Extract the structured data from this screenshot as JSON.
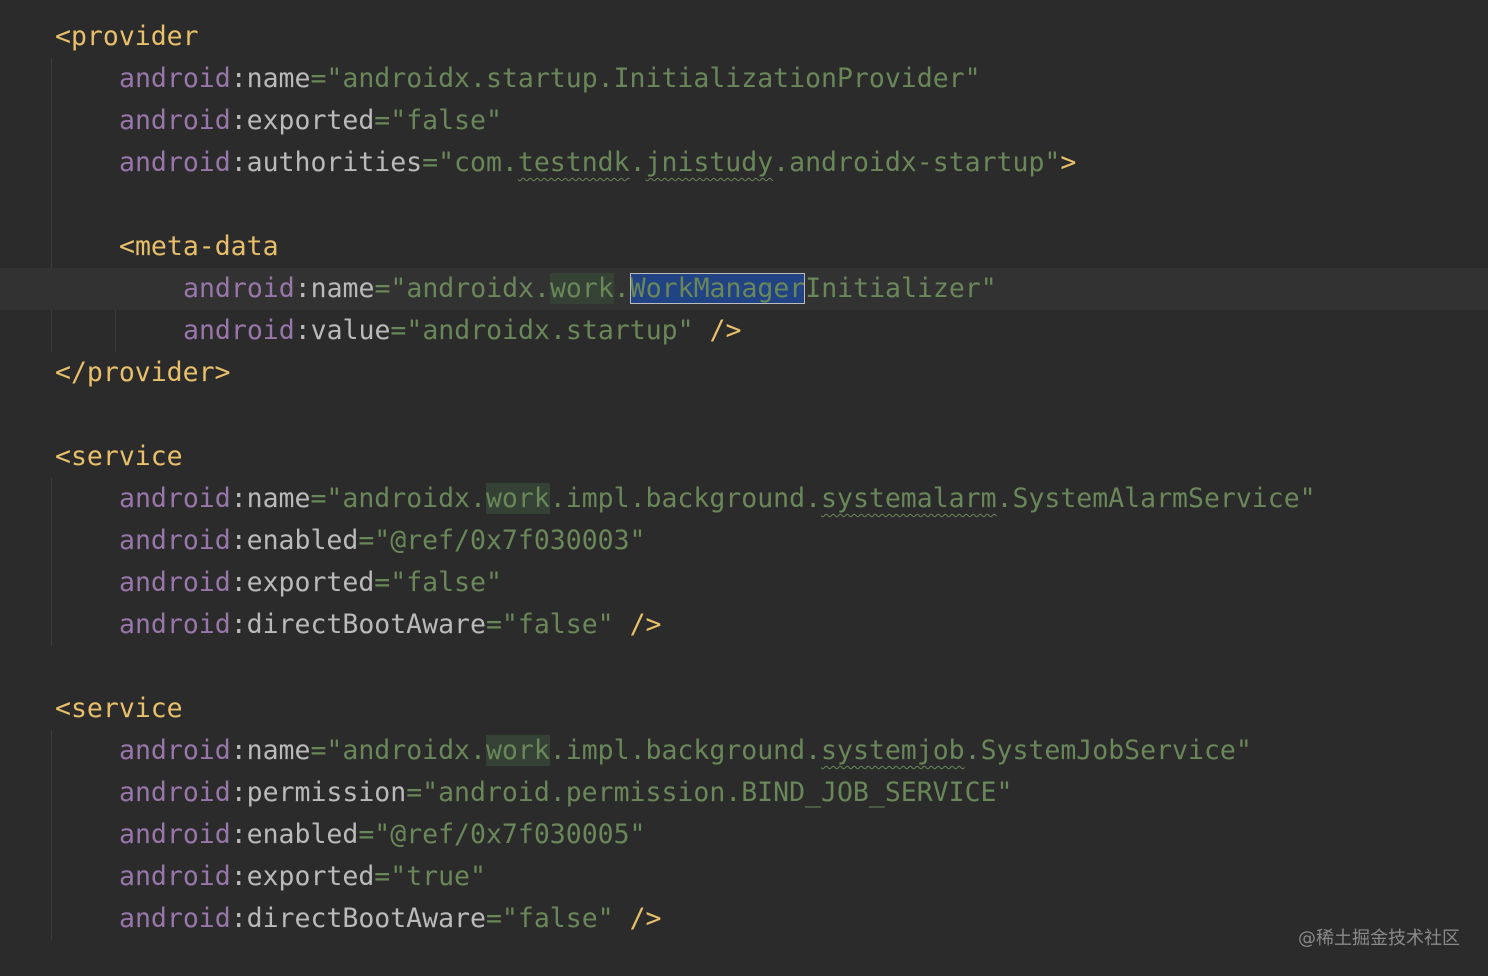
{
  "editor": {
    "file_language": "XML",
    "watermark": "@稀土掘金技术社区",
    "lines": [
      {
        "indent": 0,
        "tokens": [
          {
            "t": "tag",
            "v": "<provider"
          }
        ]
      },
      {
        "indent": 1,
        "tokens": [
          {
            "t": "ns",
            "v": "android"
          },
          {
            "t": "attr",
            "v": ":name"
          },
          {
            "t": "val",
            "v": "=\"androidx.startup.InitializationProvider\""
          }
        ]
      },
      {
        "indent": 1,
        "tokens": [
          {
            "t": "ns",
            "v": "android"
          },
          {
            "t": "attr",
            "v": ":exported"
          },
          {
            "t": "val",
            "v": "=\"false\""
          }
        ]
      },
      {
        "indent": 1,
        "tokens": [
          {
            "t": "ns",
            "v": "android"
          },
          {
            "t": "attr",
            "v": ":authorities"
          },
          {
            "t": "val",
            "v": "=\"com."
          },
          {
            "t": "val",
            "v": "testndk",
            "typo": true
          },
          {
            "t": "val",
            "v": "."
          },
          {
            "t": "val",
            "v": "jnistudy",
            "typo": true
          },
          {
            "t": "val",
            "v": ".androidx-startup\""
          },
          {
            "t": "punct",
            "v": ">"
          }
        ]
      },
      {
        "indent": 0,
        "tokens": []
      },
      {
        "indent": 1,
        "tokens": [
          {
            "t": "tag",
            "v": "<meta-data"
          }
        ]
      },
      {
        "indent": 2,
        "current": true,
        "tokens": [
          {
            "t": "ns",
            "v": "android"
          },
          {
            "t": "attr",
            "v": ":name"
          },
          {
            "t": "val",
            "v": "=\"androidx."
          },
          {
            "t": "val",
            "v": "work",
            "hl": "match"
          },
          {
            "t": "val",
            "v": "."
          },
          {
            "t": "val",
            "v": "WorkManager",
            "hl": "sel"
          },
          {
            "t": "val",
            "v": "Initializer\""
          }
        ]
      },
      {
        "indent": 2,
        "tokens": [
          {
            "t": "ns",
            "v": "android"
          },
          {
            "t": "attr",
            "v": ":value"
          },
          {
            "t": "val",
            "v": "=\"androidx.startup\" "
          },
          {
            "t": "punct",
            "v": "/>"
          }
        ]
      },
      {
        "indent": 0,
        "tokens": [
          {
            "t": "tag",
            "v": "</provider>"
          }
        ]
      },
      {
        "indent": 0,
        "tokens": []
      },
      {
        "indent": 0,
        "tokens": [
          {
            "t": "tag",
            "v": "<service"
          }
        ]
      },
      {
        "indent": 1,
        "tokens": [
          {
            "t": "ns",
            "v": "android"
          },
          {
            "t": "attr",
            "v": ":name"
          },
          {
            "t": "val",
            "v": "=\"androidx."
          },
          {
            "t": "val",
            "v": "work",
            "hl": "match"
          },
          {
            "t": "val",
            "v": ".impl.background."
          },
          {
            "t": "val",
            "v": "systemalarm",
            "typo": true
          },
          {
            "t": "val",
            "v": ".SystemAlarmService\""
          }
        ]
      },
      {
        "indent": 1,
        "tokens": [
          {
            "t": "ns",
            "v": "android"
          },
          {
            "t": "attr",
            "v": ":enabled"
          },
          {
            "t": "val",
            "v": "=\"@ref/0x7f030003\""
          }
        ]
      },
      {
        "indent": 1,
        "tokens": [
          {
            "t": "ns",
            "v": "android"
          },
          {
            "t": "attr",
            "v": ":exported"
          },
          {
            "t": "val",
            "v": "=\"false\""
          }
        ]
      },
      {
        "indent": 1,
        "tokens": [
          {
            "t": "ns",
            "v": "android"
          },
          {
            "t": "attr",
            "v": ":directBootAware"
          },
          {
            "t": "val",
            "v": "=\"false\" "
          },
          {
            "t": "punct",
            "v": "/>"
          }
        ]
      },
      {
        "indent": 0,
        "tokens": []
      },
      {
        "indent": 0,
        "tokens": [
          {
            "t": "tag",
            "v": "<service"
          }
        ]
      },
      {
        "indent": 1,
        "tokens": [
          {
            "t": "ns",
            "v": "android"
          },
          {
            "t": "attr",
            "v": ":name"
          },
          {
            "t": "val",
            "v": "=\"androidx."
          },
          {
            "t": "val",
            "v": "work",
            "hl": "match"
          },
          {
            "t": "val",
            "v": ".impl.background."
          },
          {
            "t": "val",
            "v": "systemjob",
            "typo": true
          },
          {
            "t": "val",
            "v": ".SystemJobService\""
          }
        ]
      },
      {
        "indent": 1,
        "tokens": [
          {
            "t": "ns",
            "v": "android"
          },
          {
            "t": "attr",
            "v": ":permission"
          },
          {
            "t": "val",
            "v": "=\"android.permission.BIND_JOB_SERVICE\""
          }
        ]
      },
      {
        "indent": 1,
        "tokens": [
          {
            "t": "ns",
            "v": "android"
          },
          {
            "t": "attr",
            "v": ":enabled"
          },
          {
            "t": "val",
            "v": "=\"@ref/0x7f030005\""
          }
        ]
      },
      {
        "indent": 1,
        "tokens": [
          {
            "t": "ns",
            "v": "android"
          },
          {
            "t": "attr",
            "v": ":exported"
          },
          {
            "t": "val",
            "v": "=\"true\""
          }
        ]
      },
      {
        "indent": 1,
        "tokens": [
          {
            "t": "ns",
            "v": "android"
          },
          {
            "t": "attr",
            "v": ":directBootAware"
          },
          {
            "t": "val",
            "v": "=\"false\" "
          },
          {
            "t": "punct",
            "v": "/>"
          }
        ]
      }
    ]
  }
}
